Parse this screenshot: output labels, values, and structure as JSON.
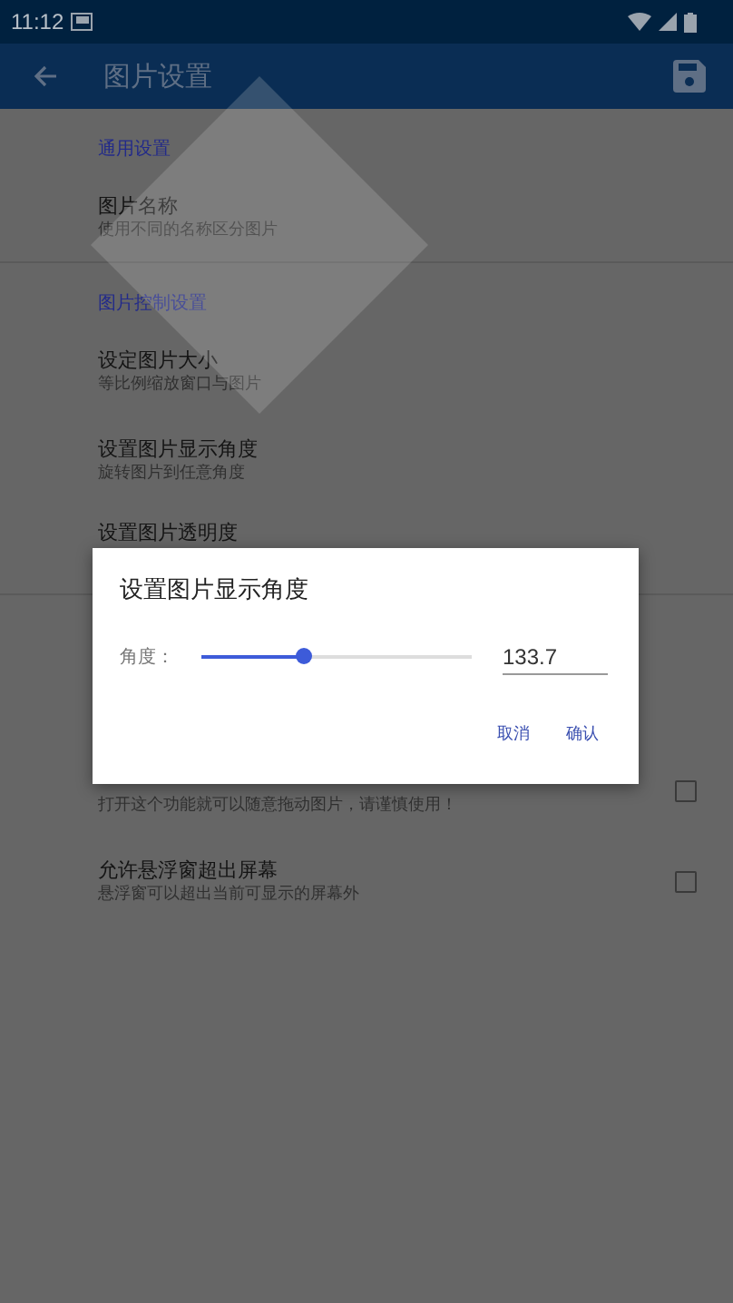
{
  "status_bar": {
    "time": "11:12"
  },
  "app_bar": {
    "title": "图片设置"
  },
  "sections": [
    {
      "category": "通用设置",
      "items": [
        {
          "title": "图片名称",
          "subtitle": "使用不同的名称区分图片"
        }
      ]
    },
    {
      "category": "图片控制设置",
      "items": [
        {
          "title": "设定图片大小",
          "subtitle": "等比例缩放窗口与图片"
        },
        {
          "title": "设置图片显示角度",
          "subtitle": "旋转图片到任意角度"
        },
        {
          "title": "设置图片透明度"
        }
      ]
    },
    {
      "items": [
        {
          "subtitle": "打开这个功能就可以随意拖动图片，请谨慎使用！",
          "checked": false
        },
        {
          "title": "允许悬浮窗超出屏幕",
          "subtitle": "悬浮窗可以超出当前可显示的屏幕外",
          "checked": false
        }
      ]
    }
  ],
  "dialog": {
    "title": "设置图片显示角度",
    "label": "角度：",
    "level": 0.376,
    "value": "133.7",
    "buttons": [
      "取消",
      "确认"
    ]
  }
}
